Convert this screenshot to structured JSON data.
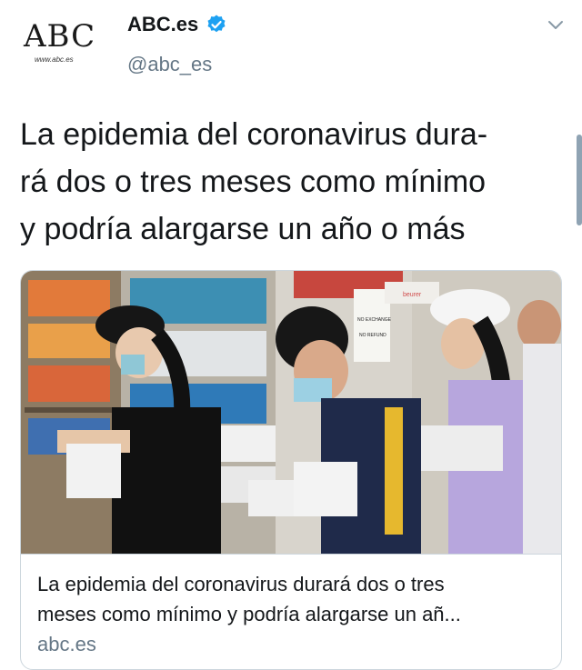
{
  "tweet": {
    "author": {
      "avatar_logo": "ABC",
      "avatar_url": "www.abc.es",
      "display_name": "ABC.es",
      "handle": "@abc_es",
      "verified": true
    },
    "text_lines": [
      "La epidemia del coronavirus dura-",
      "rá dos o tres meses como mínimo",
      "y podría alargarse un año o más"
    ],
    "card": {
      "image_alt": "people wearing masks shopping for medical supplies",
      "image_signs": [
        "NO EXCHANGE",
        "NO REFUND",
        "beurer"
      ],
      "title_lines": [
        "La epidemia del coronavirus durará dos o tres",
        "meses como mínimo y podría alargarse un añ..."
      ],
      "domain": "abc.es"
    }
  },
  "icons": {
    "verified": "verified-badge-icon",
    "menu": "chevron-down-icon"
  },
  "colors": {
    "verified_blue": "#1da1f2",
    "secondary_text": "#657786",
    "border": "#ccd6dd"
  }
}
